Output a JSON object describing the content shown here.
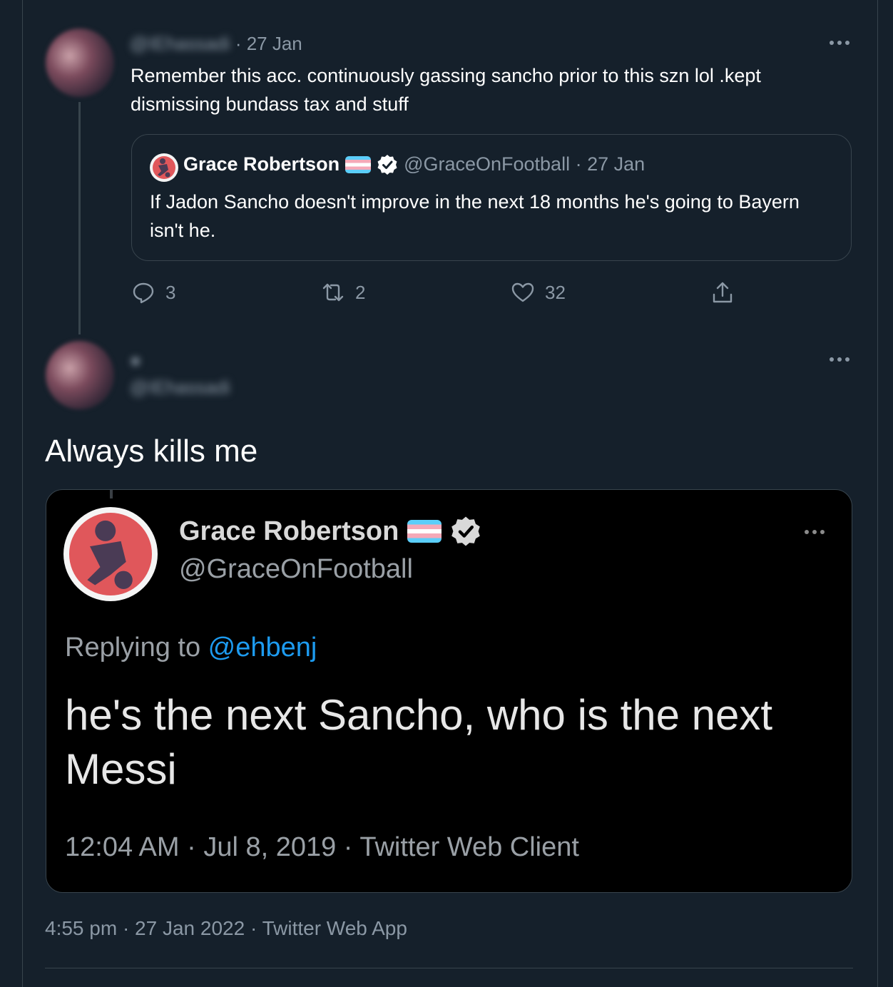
{
  "reply_tweet": {
    "handle": "@IEhassadi",
    "time": "· 27 Jan",
    "text": "Remember this acc. continuously gassing sancho prior to this szn lol .kept dismissing bundass tax and stuff",
    "quoted": {
      "name": "Grace Robertson",
      "handle_time": "@GraceOnFootball · 27 Jan",
      "text": "If Jadon Sancho doesn't improve in the next 18 months he's going to Bayern isn't he."
    },
    "actions": {
      "replies": "3",
      "retweets": "2",
      "likes": "32"
    }
  },
  "main_tweet": {
    "handle": "@IEhassadi",
    "text": "Always kills me",
    "embedded": {
      "name": "Grace Robertson",
      "handle": "@GraceOnFootball",
      "replying_prefix": "Replying to ",
      "replying_to": "@ehbenj",
      "text": "he's the next Sancho, who is the next Messi",
      "meta": "12:04 AM · Jul 8, 2019 · Twitter Web Client"
    },
    "meta": "4:55 pm · 27 Jan 2022 · Twitter Web App"
  },
  "colors": {
    "background": "#15202b",
    "border": "#38444d",
    "secondary_text": "#8b98a5",
    "link": "#1d9bf0"
  }
}
